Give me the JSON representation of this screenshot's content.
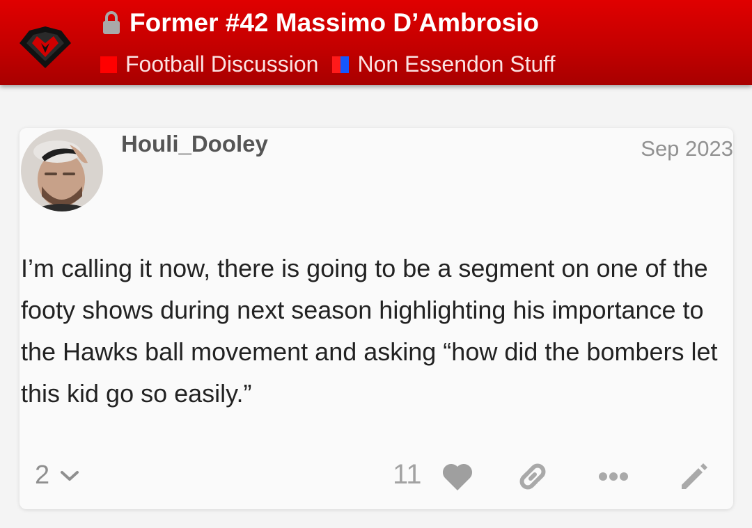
{
  "header": {
    "title": "Former #42 Massimo D’Ambrosio",
    "categories": [
      {
        "label": "Football Discussion",
        "color": "#ff0000"
      },
      {
        "label": "Non Essendon Stuff",
        "color": "#1457ff"
      }
    ],
    "colors": {
      "bar": "#c40000"
    }
  },
  "post": {
    "username": "Houli_Dooley",
    "date": "Sep 2023",
    "body": "I’m calling it now, there is going to be a segment on one of the footy shows during next season highlighting his importance to the Hawks ball movement and asking “how did the bombers let this kid go so easily.”",
    "reply_count": "2",
    "like_count": "11"
  },
  "icons": {
    "lock": "lock-icon",
    "heart": "heart-icon",
    "link": "link-icon",
    "more": "more-icon",
    "edit": "edit-icon",
    "chevron": "chevron-down-icon"
  }
}
